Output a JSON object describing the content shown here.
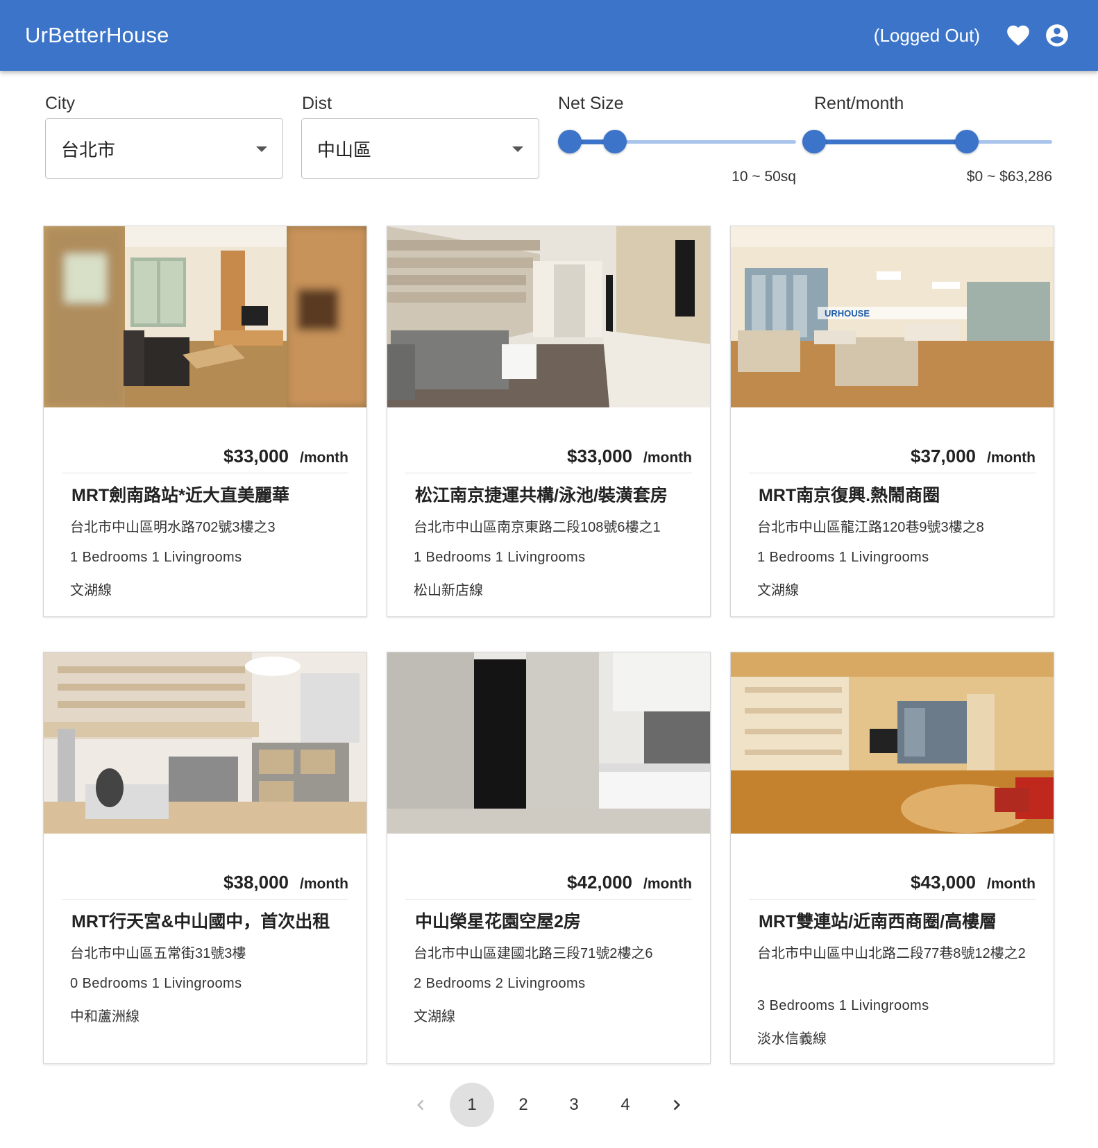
{
  "app": {
    "brand": "UrBetterHouse",
    "login_status": "(Logged Out)",
    "accent": "#3b74c9",
    "icons": {
      "favorites": "heart-icon",
      "account": "account-circle-icon"
    }
  },
  "filters": {
    "city": {
      "label": "City",
      "value": "台北市"
    },
    "dist": {
      "label": "Dist",
      "value": "中山區"
    },
    "net_size": {
      "label": "Net Size",
      "display": "10 ~ 50sq",
      "range_fraction": [
        0.05,
        0.24
      ]
    },
    "rent": {
      "label": "Rent/month",
      "display": "$0 ~ $63,286",
      "range_fraction": [
        0.0,
        0.64
      ]
    }
  },
  "listings": [
    {
      "price": "$33,000",
      "per": "/month",
      "title": "MRT劍南路站*近大直美麗華",
      "address": "台北市中山區明水路702號3樓之3",
      "rooms": "1  Bedrooms  1  Livingrooms",
      "mrt": "文湖線"
    },
    {
      "price": "$33,000",
      "per": "/month",
      "title": "松江南京捷運共構/泳池/裝潢套房",
      "address": "台北市中山區南京東路二段108號6樓之1",
      "rooms": "1  Bedrooms  1  Livingrooms",
      "mrt": "松山新店線"
    },
    {
      "price": "$37,000",
      "per": "/month",
      "title": "MRT南京復興.熱鬧商圈",
      "address": "台北市中山區龍江路120巷9號3樓之8",
      "rooms": "1  Bedrooms  1  Livingrooms",
      "mrt": "文湖線"
    },
    {
      "price": "$38,000",
      "per": "/month",
      "title": "MRT行天宮&中山國中，首次出租",
      "address": "台北市中山區五常街31號3樓",
      "rooms": "0  Bedrooms  1  Livingrooms",
      "mrt": "中和蘆洲線"
    },
    {
      "price": "$42,000",
      "per": "/month",
      "title": "中山榮星花園空屋2房",
      "address": "台北市中山區建國北路三段71號2樓之6",
      "rooms": "2  Bedrooms  2  Livingrooms",
      "mrt": "文湖線"
    },
    {
      "price": "$43,000",
      "per": "/month",
      "title": "MRT雙連站/近南西商圈/高樓層",
      "address": "台北市中山區中山北路二段77巷8號12樓之2",
      "rooms": "3  Bedrooms  1  Livingrooms",
      "mrt": "淡水信義線"
    }
  ],
  "pagination": {
    "pages": [
      "1",
      "2",
      "3",
      "4"
    ],
    "current": "1",
    "icons": {
      "prev": "chevron-left-icon",
      "next": "chevron-right-icon"
    }
  }
}
